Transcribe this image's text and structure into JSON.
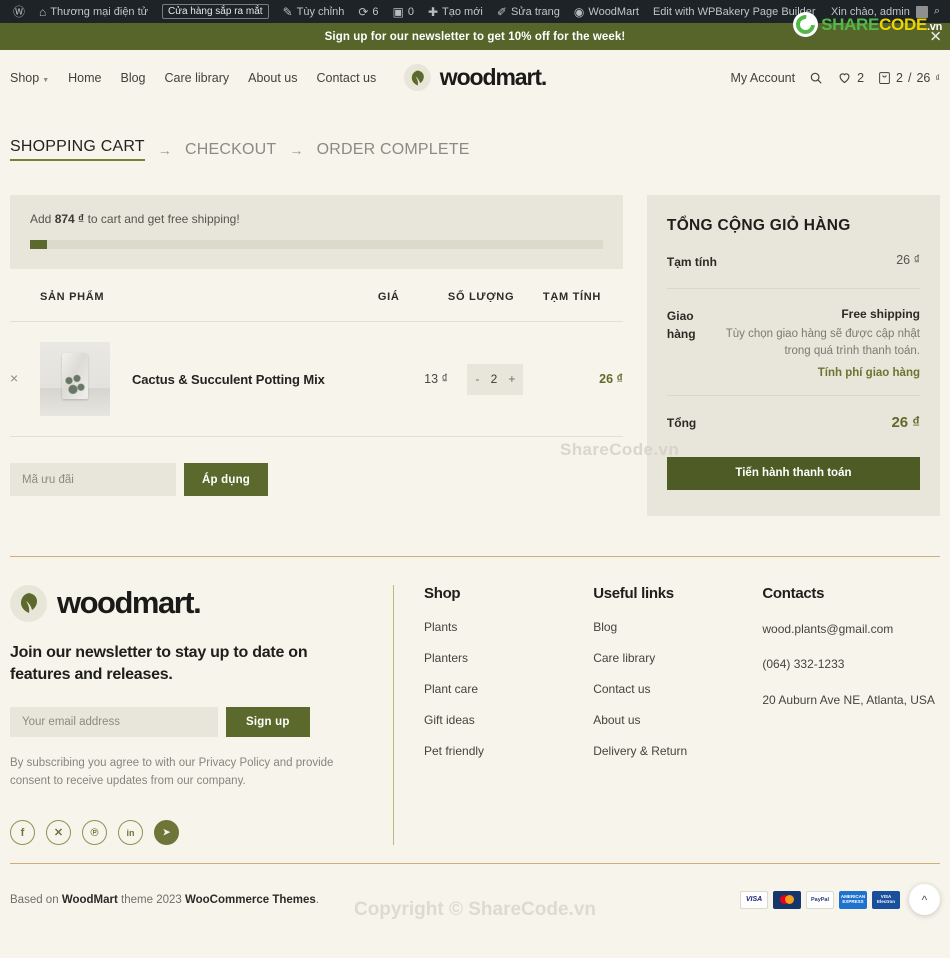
{
  "admin_bar": {
    "items": [
      {
        "icon": "wordpress-icon",
        "label": ""
      },
      {
        "icon": "site-icon",
        "label": "Thương mại điện tử"
      },
      {
        "icon": "",
        "label": "Cửa hàng sắp ra mắt",
        "chip": true
      },
      {
        "icon": "customize-icon",
        "label": "Tùy chỉnh"
      },
      {
        "icon": "updates-icon",
        "label": "6"
      },
      {
        "icon": "comments-icon",
        "label": "0"
      },
      {
        "icon": "plus-icon",
        "label": "Tạo mới"
      },
      {
        "icon": "edit-icon",
        "label": "Sửa trang"
      },
      {
        "icon": "woodmart-icon",
        "label": "WoodMart"
      },
      {
        "icon": "",
        "label": "Edit with WPBakery Page Builder"
      }
    ],
    "greeting": "Xin chào, admin",
    "search_icon": "search-icon"
  },
  "promo": {
    "text": "Sign up for our newsletter to get 10% off for the week!",
    "close": "✕"
  },
  "watermark": {
    "brand_share": "SHARE",
    "brand_code": "CODE",
    "brand_vn": ".vn",
    "center": "ShareCode.vn",
    "bottom": "Copyright © ShareCode.vn"
  },
  "header": {
    "nav": [
      {
        "label": "Shop",
        "has_dropdown": true
      },
      {
        "label": "Home",
        "has_dropdown": false
      },
      {
        "label": "Blog",
        "has_dropdown": false
      },
      {
        "label": "Care library",
        "has_dropdown": false
      },
      {
        "label": "About us",
        "has_dropdown": false
      },
      {
        "label": "Contact us",
        "has_dropdown": false
      }
    ],
    "logo_text": "woodmart.",
    "account_label": "My Account",
    "wishlist_count": "2",
    "cart_count": "2",
    "cart_separator": "/",
    "cart_total": "26",
    "currency": "₫"
  },
  "steps": [
    {
      "label": "SHOPPING CART",
      "active": true
    },
    {
      "label": "CHECKOUT",
      "active": false
    },
    {
      "label": "ORDER COMPLETE",
      "active": false
    }
  ],
  "free_shipping": {
    "prefix": "Add",
    "amount": "874 ₫",
    "suffix": "to cart and get free shipping!",
    "progress_percent": 3
  },
  "cart_table": {
    "headers": {
      "product": "SẢN PHẨM",
      "price": "GIÁ",
      "quantity": "SỐ LƯỢNG",
      "subtotal": "TẠM TÍNH"
    },
    "rows": [
      {
        "remove": "×",
        "name": "Cactus & Succulent Potting Mix",
        "price": "13 ₫",
        "qty_minus": "-",
        "qty": "2",
        "qty_plus": "+",
        "subtotal": "26 ₫"
      }
    ]
  },
  "coupon": {
    "placeholder": "Mã ưu đãi",
    "value": "",
    "button": "Áp dụng"
  },
  "totals": {
    "title": "TỔNG CỘNG GIỎ HÀNG",
    "subtotal_label": "Tạm tính",
    "subtotal_value": "26 ₫",
    "shipping_label": "Giao hàng",
    "shipping_method": "Free shipping",
    "shipping_note": "Tùy chọn giao hàng sẽ được cập nhật trong quá trình thanh toán.",
    "shipping_link": "Tính phí giao hàng",
    "total_label": "Tổng",
    "total_value": "26 ₫",
    "checkout_button": "Tiến hành thanh toán"
  },
  "footer": {
    "logo_text": "woodmart.",
    "tagline": "Join our newsletter to stay up to date on features and releases.",
    "email_placeholder": "Your email address",
    "signup_button": "Sign up",
    "legal": "By subscribing you agree to with our Privacy Policy and provide consent to receive updates from our company.",
    "socials": [
      {
        "name": "facebook-icon",
        "glyph": "f",
        "filled": false
      },
      {
        "name": "x-twitter-icon",
        "glyph": "✕",
        "filled": false
      },
      {
        "name": "pinterest-icon",
        "glyph": "℗",
        "filled": false
      },
      {
        "name": "linkedin-icon",
        "glyph": "in",
        "filled": false
      },
      {
        "name": "telegram-icon",
        "glyph": "➤",
        "filled": true
      }
    ],
    "columns": [
      {
        "title": "Shop",
        "links": [
          "Plants",
          "Planters",
          "Plant care",
          "Gift ideas",
          "Pet friendly"
        ]
      },
      {
        "title": "Useful links",
        "links": [
          "Blog",
          "Care library",
          "Contact us",
          "About us",
          "Delivery & Return"
        ]
      },
      {
        "title": "Contacts",
        "links": [
          "wood.plants@gmail.com",
          "(064) 332-1233",
          "20 Auburn Ave NE, Atlanta, USA"
        ]
      }
    ],
    "copyright_prefix": "Based on",
    "copyright_brand": "WoodMart",
    "copyright_mid": "theme 2023",
    "copyright_brand2": "WooCommerce Themes",
    "copyright_suffix": ".",
    "payments": [
      "VISA",
      "mastercard",
      "PayPal",
      "AMERICAN EXPRESS",
      "VISA Electron"
    ],
    "scroll_top": "^"
  },
  "colors": {
    "olive": "#5b6a2c",
    "olive_dark": "#4f5b24",
    "cream": "#f7f4ec",
    "panel": "#e8e6da",
    "accent_gold": "#cfae7a"
  }
}
